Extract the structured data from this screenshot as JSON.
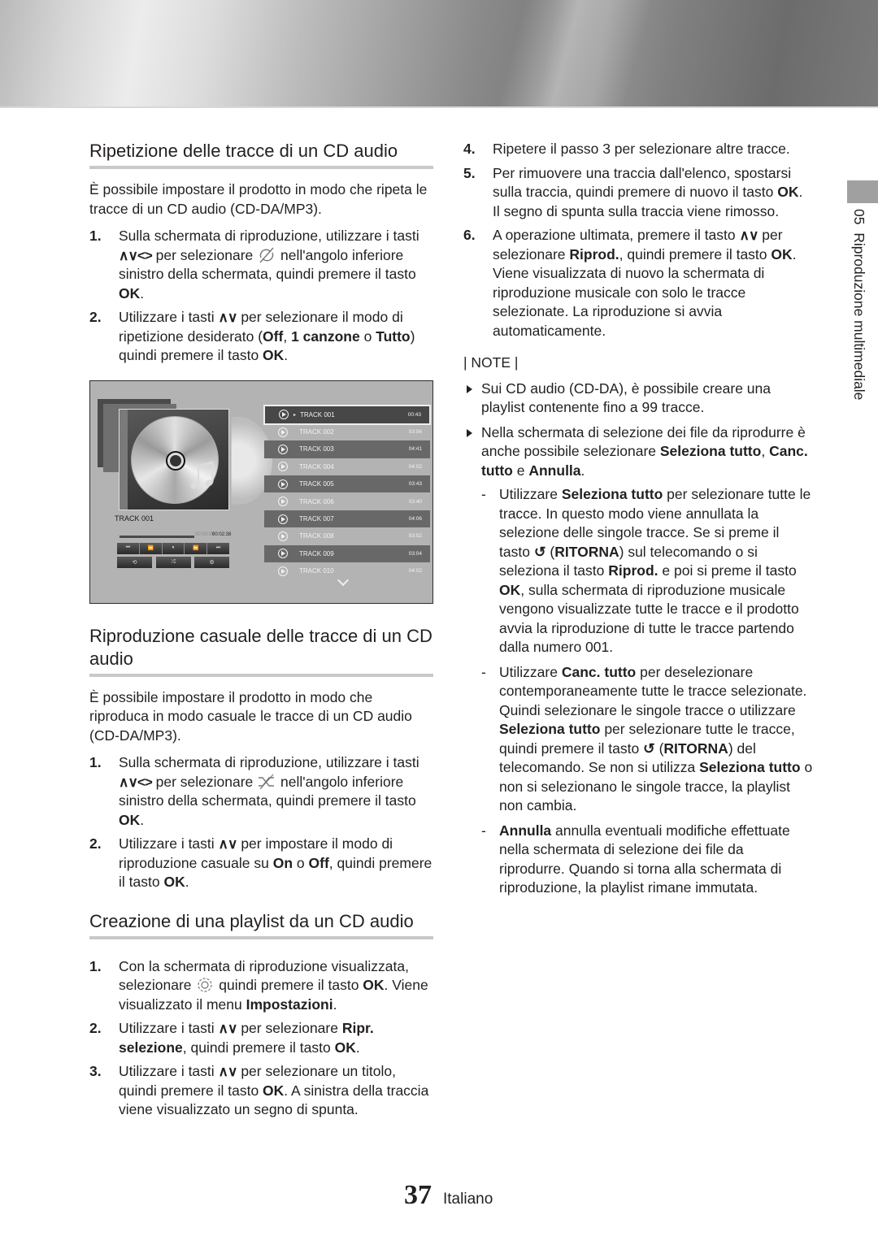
{
  "sidebar": {
    "chapter_number": "05",
    "chapter_title": "Riproduzione multimediale"
  },
  "sections": {
    "repeat": {
      "title": "Ripetizione delle tracce di un CD audio",
      "intro": "È possibile impostare il prodotto in modo che ripeta le tracce di un CD audio (CD-DA/MP3).",
      "steps": [
        {
          "num": "1.",
          "a": "Sulla schermata di riproduzione, utilizzare i tasti",
          "keys": "∧∨<>",
          "b": "per selezionare",
          "icon": "repeat-off-icon",
          "c": "nell'angolo inferiore sinistro della schermata, quindi premere il tasto",
          "bold1": "OK",
          "d": "."
        },
        {
          "num": "2.",
          "a": "Utilizzare i tasti",
          "keys": "∧∨",
          "b": "per selezionare il modo di ripetizione desiderato (",
          "bold1": "Off",
          "c": ",",
          "bold2": "1 canzone",
          "d": "o",
          "bold3": "Tutto",
          "e": ") quindi premere il tasto",
          "bold4": "OK",
          "f": "."
        }
      ]
    },
    "shuffle": {
      "title": "Riproduzione casuale delle tracce di un CD audio",
      "intro": "È possibile impostare il prodotto in modo che riproduca in modo casuale le tracce di un CD audio (CD-DA/MP3).",
      "steps": [
        {
          "num": "1.",
          "a": "Sulla schermata di riproduzione, utilizzare i tasti",
          "keys": "∧∨<>",
          "b": "per selezionare",
          "icon": "shuffle-icon",
          "c": "nell'angolo inferiore sinistro della schermata, quindi premere il tasto",
          "bold1": "OK",
          "d": "."
        },
        {
          "num": "2.",
          "a": "Utilizzare i tasti",
          "keys": "∧∨",
          "b": "per impostare il modo di riproduzione casuale su",
          "bold1": "On",
          "c": "o",
          "bold2": "Off",
          "d": ", quindi premere il tasto",
          "bold3": "OK",
          "e": "."
        }
      ]
    },
    "playlist": {
      "title": "Creazione di una playlist da un CD audio",
      "steps": [
        {
          "num": "1.",
          "a": "Con la schermata di riproduzione visualizzata, selezionare",
          "icon": "settings-gear-icon",
          "b": "quindi premere il tasto",
          "bold1": "OK",
          "c": ". Viene visualizzato il menu",
          "bold2": "Impostazioni",
          "d": "."
        },
        {
          "num": "2.",
          "a": "Utilizzare i tasti",
          "keys": "∧∨",
          "b": "per selezionare",
          "bold1": "Ripr. selezione",
          "c": ", quindi premere il tasto",
          "bold2": "OK",
          "d": "."
        },
        {
          "num": "3.",
          "a": "Utilizzare i tasti",
          "keys": "∧∨",
          "b": "per selezionare un titolo, quindi premere il tasto",
          "bold1": "OK",
          "c": ". A sinistra della traccia viene visualizzato un segno di spunta."
        },
        {
          "num": "4.",
          "a": "Ripetere il passo 3 per selezionare altre tracce."
        },
        {
          "num": "5.",
          "a": "Per rimuovere una traccia dall'elenco, spostarsi sulla traccia, quindi premere di nuovo il tasto",
          "bold1": "OK",
          "b": ". Il segno di spunta sulla traccia viene rimosso."
        },
        {
          "num": "6.",
          "a": "A operazione ultimata, premere il tasto",
          "keys": "∧∨",
          "b": "per selezionare",
          "bold1": "Riprod.",
          "c": ", quindi premere il tasto",
          "bold2": "OK",
          "d": ". Viene visualizzata di nuovo la schermata di riproduzione musicale con solo le tracce selezionate. La riproduzione si avvia automaticamente."
        }
      ]
    }
  },
  "notes": {
    "label": "| NOTE |",
    "items": [
      {
        "text": "Sui CD audio (CD-DA), è possibile creare una playlist contenente fino a 99 tracce."
      },
      {
        "a": "Nella schermata di selezione dei file da riprodurre è anche possibile selezionare",
        "bold1": "Seleziona tutto",
        "b": ",",
        "bold2": "Canc. tutto",
        "c": "e",
        "bold3": "Annulla",
        "d": "."
      }
    ],
    "sub": [
      {
        "a": "Utilizzare",
        "bold1": "Seleziona tutto",
        "b": "per selezionare tutte le tracce. In questo modo viene annullata la selezione delle singole tracce. Se si preme il tasto",
        "icon": "↺",
        "bold2": "RITORNA",
        "c": "sul telecomando o si seleziona il tasto",
        "bold3": "Riprod.",
        "d": "e poi si preme il tasto",
        "bold4": "OK",
        "e": ", sulla schermata di riproduzione musicale vengono visualizzate tutte le tracce e il prodotto avvia la riproduzione di tutte le tracce partendo dalla numero 001."
      },
      {
        "a": "Utilizzare",
        "bold1": "Canc. tutto",
        "b": "per deselezionare contemporaneamente tutte le tracce selezionate. Quindi selezionare le singole tracce o utilizzare",
        "bold2": "Seleziona tutto",
        "c": "per selezionare tutte le tracce, quindi premere il tasto",
        "icon": "↺",
        "bold3": "RITORNA",
        "d": "del telecomando. Se non si utilizza",
        "bold4": "Seleziona tutto",
        "e": "o non si selezionano le singole tracce, la playlist non cambia."
      },
      {
        "bold1": "Annulla",
        "a": "annulla eventuali modifiche effettuate nella schermata di selezione dei file da riprodurre. Quando si torna alla schermata di riproduzione, la playlist rimane immutata."
      }
    ]
  },
  "player": {
    "now_playing": "TRACK 001",
    "time_elapsed": "00:00:09",
    "time_total": "00:02:38",
    "controls": [
      "⏮",
      "⏪",
      "⏸",
      "⏩",
      "⏭"
    ],
    "controls2": [
      "repeat",
      "shuffle",
      "settings"
    ],
    "tracks": [
      {
        "name": "TRACK 001",
        "duration": "00:43",
        "selected": true
      },
      {
        "name": "TRACK 002",
        "duration": "03:56"
      },
      {
        "name": "TRACK 003",
        "duration": "04:41"
      },
      {
        "name": "TRACK 004",
        "duration": "04:02"
      },
      {
        "name": "TRACK 005",
        "duration": "03:43"
      },
      {
        "name": "TRACK 006",
        "duration": "03:40"
      },
      {
        "name": "TRACK 007",
        "duration": "04:06"
      },
      {
        "name": "TRACK 008",
        "duration": "03:52"
      },
      {
        "name": "TRACK 009",
        "duration": "03:04"
      },
      {
        "name": "TRACK 010",
        "duration": "04:02"
      }
    ]
  },
  "footer": {
    "page_number": "37",
    "language": "Italiano"
  }
}
